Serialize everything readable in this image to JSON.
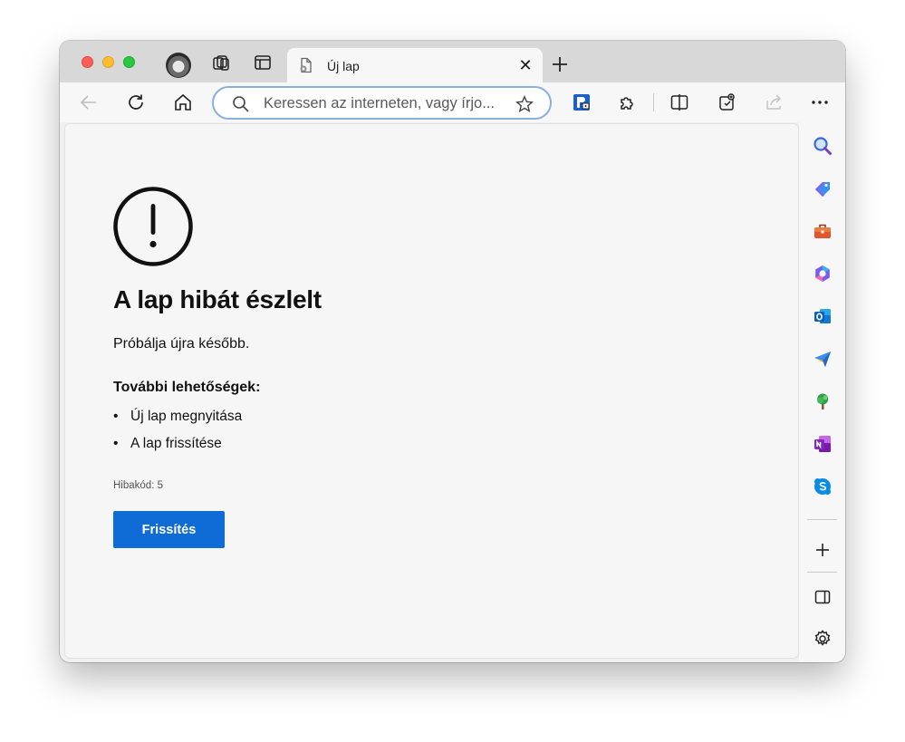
{
  "tab": {
    "title": "Új lap",
    "close_glyph": "✕"
  },
  "address": {
    "placeholder": "Keressen az interneten, vagy írjo..."
  },
  "error": {
    "title": "A lap hibát észlelt",
    "description": "Próbálja újra később.",
    "options_title": "További lehetőségek:",
    "options": [
      "Új lap megnyitása",
      "A lap frissítése"
    ],
    "code": "Hibakód: 5",
    "button_label": "Frissítés"
  },
  "toolbar_icons": [
    "back-arrow-icon",
    "refresh-icon",
    "home-icon",
    "search-icon",
    "favorite-star-icon",
    "extension-badge-icon",
    "puzzle-icon",
    "split-screen-icon",
    "collections-icon",
    "share-icon",
    "more-icon"
  ],
  "sidebar_icons": [
    "search-icon",
    "shopping-tag-icon",
    "toolbox-icon",
    "copilot-icon",
    "outlook-icon",
    "send-icon",
    "tree-icon",
    "onenote-icon",
    "skype-icon",
    "add-icon",
    "sidebar-panel-icon",
    "settings-gear-icon"
  ],
  "colors": {
    "accent": "#0f6cd6",
    "address_border": "#8aaee0",
    "error_icon": "#111111"
  }
}
